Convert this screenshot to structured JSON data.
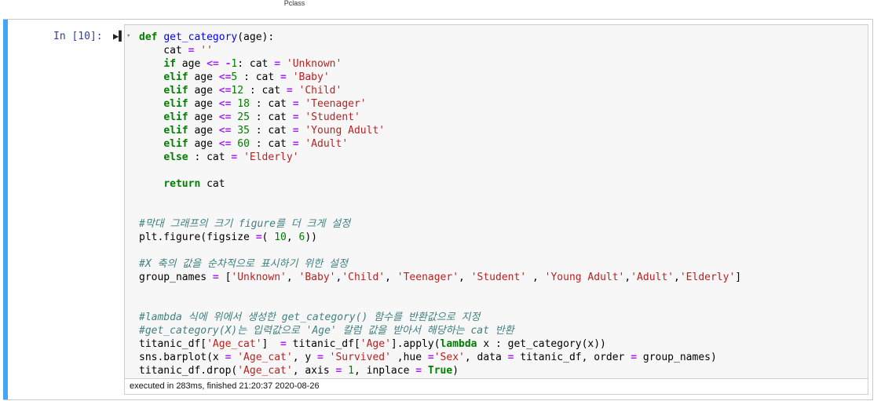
{
  "top_label": "Pclass",
  "cell": {
    "prompt": "In [10]:",
    "run_icon": "▶▌",
    "collapse_icon": "▾",
    "footer": "executed in 283ms, finished 21:20:37 2020-08-26",
    "code_lines": [
      "def get_category(age):",
      "    cat = ''",
      "    if age <= -1: cat = 'Unknown'",
      "    elif age <=5 : cat = 'Baby'",
      "    elif age <=12 : cat = 'Child'",
      "    elif age <= 18 : cat = 'Teenager'",
      "    elif age <= 25 : cat = 'Student'",
      "    elif age <= 35 : cat = 'Young Adult'",
      "    elif age <= 60 : cat = 'Adult'",
      "    else : cat = 'Elderly'",
      "",
      "    return cat",
      "",
      "",
      "#막대 그래프의 크기 figure를 더 크게 설정",
      "plt.figure(figsize =( 10, 6))",
      "",
      "#X 축의 값을 순차적으로 표시하기 위한 설정",
      "group_names = ['Unknown', 'Baby','Child', 'Teenager', 'Student' , 'Young Adult','Adult','Elderly']",
      "",
      "",
      "#lambda 식에 위에서 생성한 get_category() 함수를 반환값으로 지정",
      "#get_category(X)는 입력값으로 'Age' 칼럼 값을 받아서 해당하는 cat 반환",
      "titanic_df['Age_cat']  = titanic_df['Age'].apply(lambda x : get_category(x))",
      "sns.barplot(x = 'Age_cat', y = 'Survived' ,hue ='Sex', data = titanic_df, order = group_names)",
      "titanic_df.drop('Age_cat', axis = 1, inplace = True)"
    ]
  }
}
